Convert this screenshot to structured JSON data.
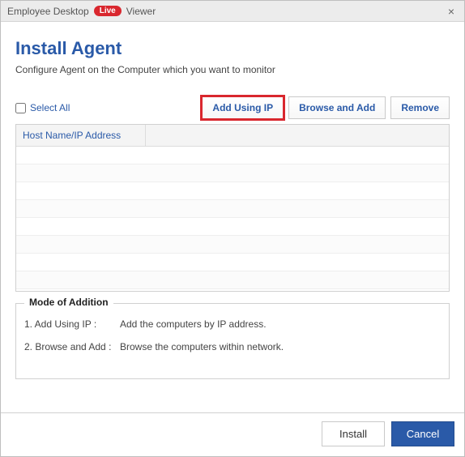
{
  "titlebar": {
    "prefix": "Employee Desktop",
    "live": "Live",
    "suffix": "Viewer"
  },
  "header": {
    "title": "Install Agent",
    "subtitle": "Configure Agent on the Computer which you want to monitor"
  },
  "toolbar": {
    "select_all_label": "Select All",
    "add_using_ip": "Add Using IP",
    "browse_and_add": "Browse and Add",
    "remove": "Remove"
  },
  "grid": {
    "col_hostname": "Host Name/IP Address",
    "rows": [
      "",
      "",
      "",
      "",
      "",
      "",
      "",
      ""
    ]
  },
  "mode": {
    "legend": "Mode of Addition",
    "items": [
      {
        "label": "1. Add Using IP :",
        "desc": "Add the computers by IP address."
      },
      {
        "label": "2. Browse and Add :",
        "desc": "Browse the computers within network."
      }
    ]
  },
  "footer": {
    "install": "Install",
    "cancel": "Cancel"
  }
}
